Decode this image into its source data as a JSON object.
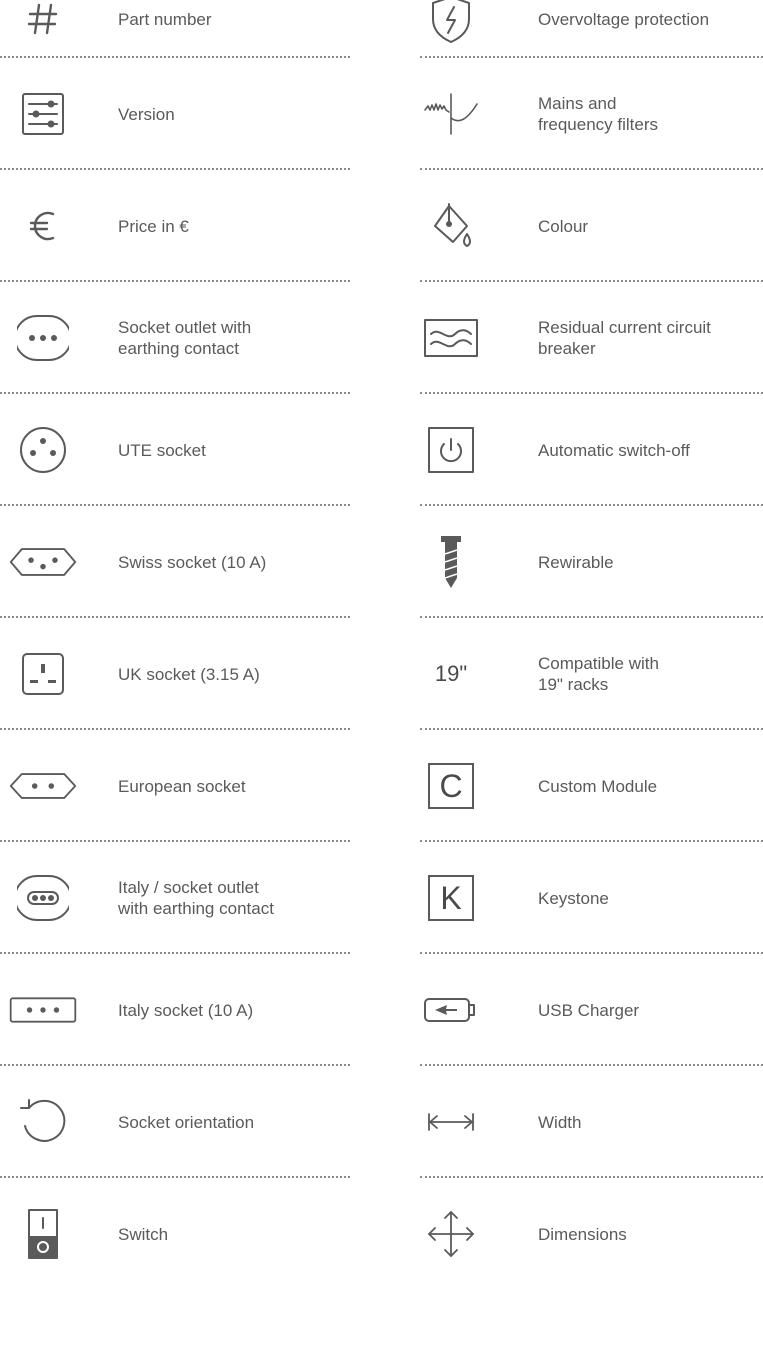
{
  "left": [
    {
      "icon": "hash-icon",
      "label": "Part number"
    },
    {
      "icon": "sliders-icon",
      "label": "Version"
    },
    {
      "icon": "euro-icon",
      "label": "Price in €"
    },
    {
      "icon": "schuko-socket-icon",
      "label": "Socket outlet with\nearthing contact"
    },
    {
      "icon": "ute-socket-icon",
      "label": "UTE socket"
    },
    {
      "icon": "swiss-socket-icon",
      "label": "Swiss socket (10 A)"
    },
    {
      "icon": "uk-socket-icon",
      "label": "UK socket (3.15 A)"
    },
    {
      "icon": "european-socket-icon",
      "label": "European socket"
    },
    {
      "icon": "italy-schuko-socket-icon",
      "label": "Italy / socket outlet\nwith earthing contact"
    },
    {
      "icon": "italy-socket-icon",
      "label": "Italy socket (10 A)"
    },
    {
      "icon": "rotate-icon",
      "label": "Socket orientation"
    },
    {
      "icon": "switch-icon",
      "label": "Switch"
    }
  ],
  "right": [
    {
      "icon": "shield-lightning-icon",
      "label": "Overvoltage protection"
    },
    {
      "icon": "filter-wave-icon",
      "label": "Mains and\nfrequency filters"
    },
    {
      "icon": "paint-bucket-icon",
      "label": "Colour"
    },
    {
      "icon": "rcd-wave-icon",
      "label": "Residual current circuit\nbreaker"
    },
    {
      "icon": "power-button-icon",
      "label": "Automatic switch-off"
    },
    {
      "icon": "screw-icon",
      "label": "Rewirable"
    },
    {
      "icon": "rack-19-icon",
      "label": "Compatible with\n19\" racks",
      "icon_text": "19\""
    },
    {
      "icon": "letter-c-icon",
      "label": "Custom Module",
      "icon_text": "C"
    },
    {
      "icon": "letter-k-icon",
      "label": "Keystone",
      "icon_text": "K"
    },
    {
      "icon": "usb-charger-icon",
      "label": "USB Charger"
    },
    {
      "icon": "width-arrow-icon",
      "label": "Width"
    },
    {
      "icon": "dimensions-arrows-icon",
      "label": "Dimensions"
    }
  ]
}
